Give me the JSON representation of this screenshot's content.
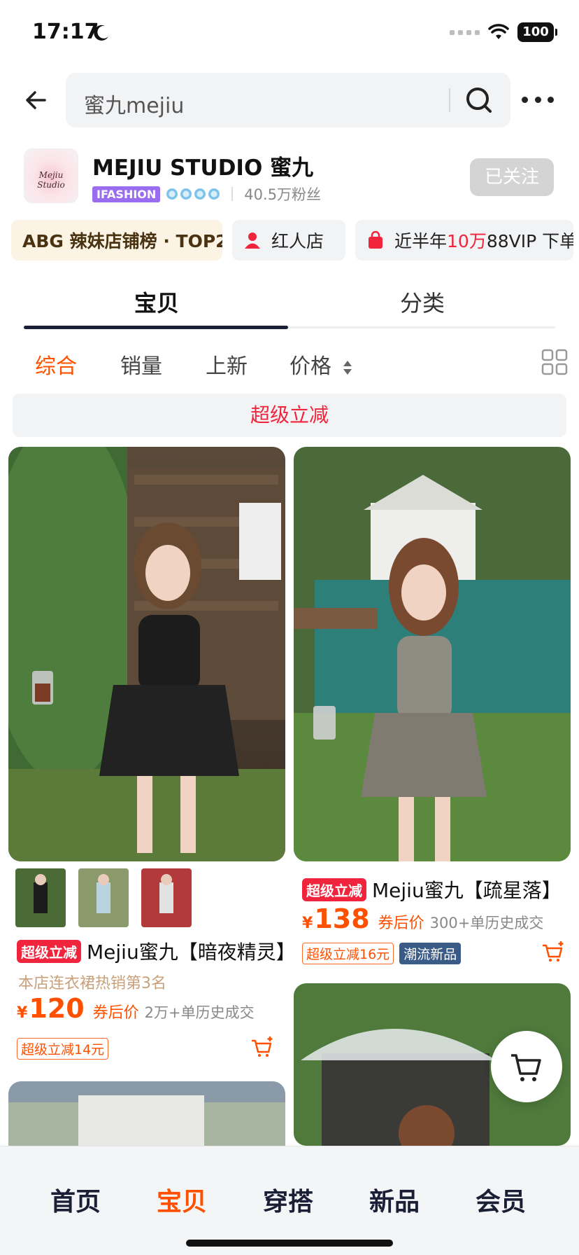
{
  "status": {
    "time": "17:17",
    "battery": "100"
  },
  "search": {
    "query": "蜜九mejiu"
  },
  "shop": {
    "name": "MEJIU STUDIO 蜜九",
    "badge": "IFASHION",
    "logo_text": "Mejiu Studio",
    "fans": "40.5万粉丝",
    "follow_label": "已关注"
  },
  "tags": {
    "top": "ABG 辣妹店铺榜 · TOP2",
    "hot": "红人店",
    "vip_prefix": "近半年",
    "vip_highlight": "10万",
    "vip_suffix": "88VIP 下单"
  },
  "main_tabs": [
    "宝贝",
    "分类"
  ],
  "sort": {
    "items": [
      "综合",
      "销量",
      "上新",
      "价格"
    ],
    "active": "综合"
  },
  "promo_banner": "超级立减",
  "products": [
    {
      "chip": "超级立减",
      "title": "Mejiu蜜九【暗夜精灵】",
      "rank": "本店连衣裙热销第3名",
      "yen": "¥",
      "price": "120",
      "after_coupon": "券后价",
      "sold": "2万+单历史成交",
      "coupon": "超级立减14元"
    },
    {
      "chip": "超级立减",
      "title": "Mejiu蜜九【疏星落】",
      "yen": "¥",
      "price": "138",
      "after_coupon": "券后价",
      "sold": "300+单历史成交",
      "coupon": "超级立减16元",
      "new_tag": "潮流新品"
    }
  ],
  "bottom_nav": {
    "items": [
      "首页",
      "宝贝",
      "穿搭",
      "新品",
      "会员"
    ],
    "active": "宝贝"
  },
  "colors": {
    "accent": "#ff5000",
    "promo_red": "#f0243c",
    "nav_dark": "#1a1f36"
  }
}
